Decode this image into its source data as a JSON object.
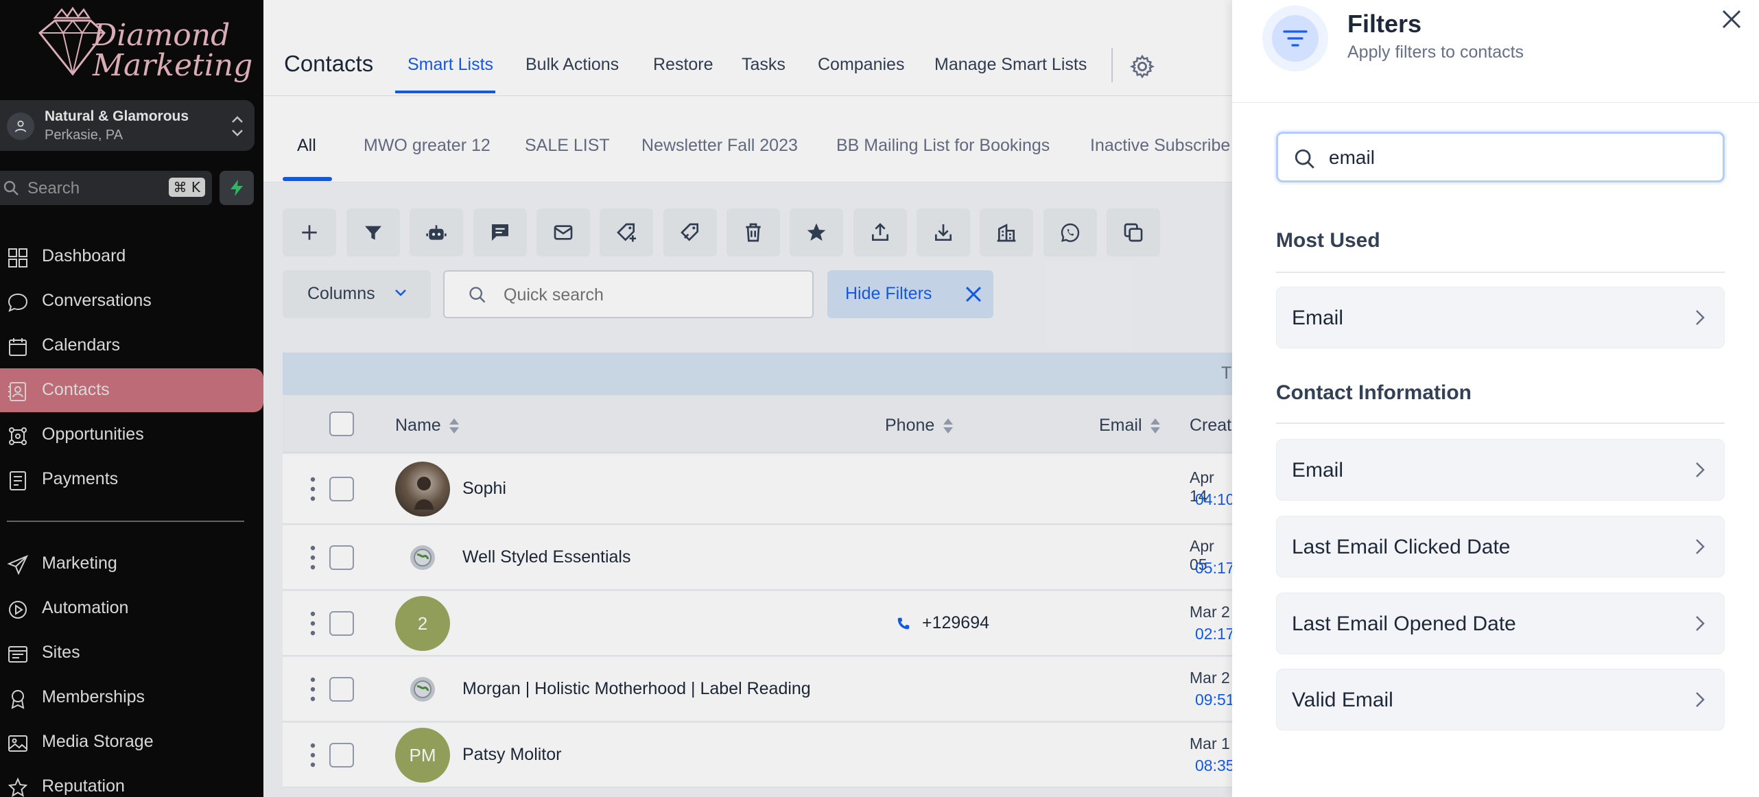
{
  "sidebar": {
    "logo_text": "Diamond\nMarketing",
    "location": {
      "name": "Natural & Glamorous",
      "sub": "Perkasie, PA"
    },
    "search": {
      "label": "Search",
      "shortcut": "⌘ K"
    },
    "nav_top": [
      {
        "label": "Dashboard",
        "icon": "dashboard-icon"
      },
      {
        "label": "Conversations",
        "icon": "chat-icon"
      },
      {
        "label": "Calendars",
        "icon": "calendar-icon"
      },
      {
        "label": "Contacts",
        "icon": "contacts-icon",
        "active": true
      },
      {
        "label": "Opportunities",
        "icon": "opportunities-icon"
      },
      {
        "label": "Payments",
        "icon": "payments-icon"
      }
    ],
    "nav_bottom": [
      {
        "label": "Marketing",
        "icon": "send-icon"
      },
      {
        "label": "Automation",
        "icon": "automation-icon"
      },
      {
        "label": "Sites",
        "icon": "sites-icon"
      },
      {
        "label": "Memberships",
        "icon": "memberships-icon"
      },
      {
        "label": "Media Storage",
        "icon": "media-icon"
      },
      {
        "label": "Reputation",
        "icon": "reputation-icon"
      }
    ]
  },
  "header": {
    "title": "Contacts",
    "tabs": [
      "Smart Lists",
      "Bulk Actions",
      "Restore",
      "Tasks",
      "Companies",
      "Manage Smart Lists"
    ],
    "active_tab": "Smart Lists"
  },
  "subtabs": [
    "All",
    "MWO greater 12",
    "SALE LIST",
    "Newsletter Fall 2023",
    "BB Mailing List for Bookings",
    "Inactive Subscribe"
  ],
  "toolbar": {
    "buttons": [
      "add-icon",
      "filter-icon",
      "robot-icon",
      "message-icon",
      "mail-icon",
      "tag-add-icon",
      "tag-remove-icon",
      "trash-icon",
      "star-icon",
      "export-icon",
      "import-icon",
      "company-icon",
      "whatsapp-icon",
      "duplicate-icon"
    ],
    "columns_label": "Columns",
    "quick_search_placeholder": "Quick search",
    "hide_filters_label": "Hide Filters"
  },
  "table": {
    "band_text": "T",
    "columns": [
      "Name",
      "Phone",
      "Email",
      "Creat"
    ],
    "rows": [
      {
        "name": "Sophi",
        "phone": "",
        "avatar": "photo",
        "date": "Apr 14",
        "time": "04:10"
      },
      {
        "name": "Well Styled Essentials",
        "phone": "",
        "avatar": "small",
        "date": "Apr 05",
        "time": "05:17"
      },
      {
        "name": "",
        "phone": "+129694",
        "avatar": "2",
        "date": "Mar 2",
        "time": "02:17"
      },
      {
        "name": "Morgan | Holistic Motherhood | Label Reading",
        "phone": "",
        "avatar": "small",
        "date": "Mar 2",
        "time": "09:51"
      },
      {
        "name": "Patsy Molitor",
        "phone": "",
        "avatar": "PM",
        "date": "Mar 1",
        "time": "08:35"
      }
    ]
  },
  "filters_panel": {
    "title": "Filters",
    "subtitle": "Apply filters to contacts",
    "search_value": "email",
    "sections": [
      {
        "title": "Most Used",
        "items": [
          "Email"
        ]
      },
      {
        "title": "Contact Information",
        "items": [
          "Email",
          "Last Email Clicked Date",
          "Last Email Opened Date",
          "Valid Email"
        ]
      }
    ]
  },
  "colors": {
    "accent": "#155eef",
    "sidebar_bg": "#0b0b0c",
    "active_nav": "#c8727f",
    "avatar_green": "#9aa85f"
  }
}
